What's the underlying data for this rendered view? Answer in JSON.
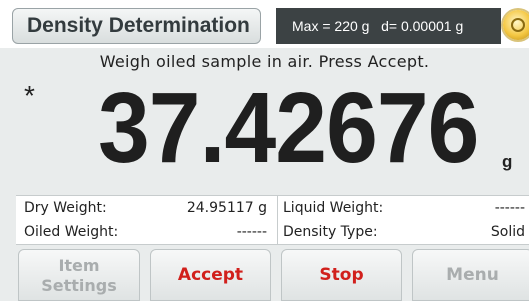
{
  "header": {
    "title": "Density Determination",
    "spec": "Max = 220 g   d= 0.00001 g",
    "level_icon": "level-bubble-icon"
  },
  "instruction": "Weigh oiled sample in air. Press Accept.",
  "reading": {
    "stability_marker": "*",
    "value": "37.42676",
    "unit": "g"
  },
  "info": {
    "dry_weight_label": "Dry Weight:",
    "dry_weight_value": "24.95117 g",
    "oiled_weight_label": "Oiled Weight:",
    "oiled_weight_value": "------",
    "liquid_weight_label": "Liquid Weight:",
    "liquid_weight_value": "------",
    "density_type_label": "Density Type:",
    "density_type_value": "Solid"
  },
  "buttons": {
    "item_settings_line1": "Item",
    "item_settings_line2": "Settings",
    "accept": "Accept",
    "stop": "Stop",
    "menu": "Menu"
  },
  "colors": {
    "accent_red": "#d1201c",
    "disabled_gray": "#a9adae",
    "spec_bg": "#3c4244"
  }
}
